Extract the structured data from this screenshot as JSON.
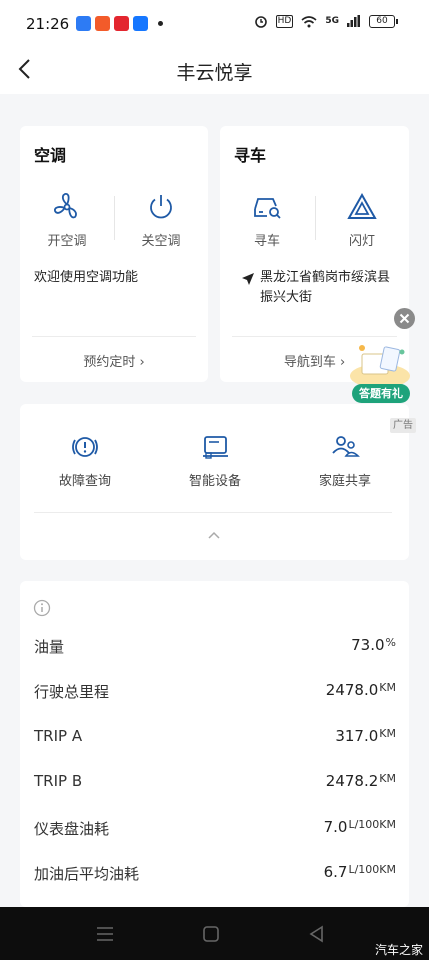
{
  "status_bar": {
    "time": "21:26",
    "battery": "60",
    "network": "5G",
    "hd": "HD"
  },
  "header": {
    "title": "丰云悦享"
  },
  "ac_card": {
    "title": "空调",
    "on_label": "开空调",
    "off_label": "关空调",
    "message": "欢迎使用空调功能",
    "link": "预约定时"
  },
  "find_card": {
    "title": "寻车",
    "find_label": "寻车",
    "flash_label": "闪灯",
    "address": "黑龙江省鹤岗市绥滨县振兴大街",
    "link": "导航到车"
  },
  "features": [
    {
      "label": "故障查询",
      "icon": "fault-icon"
    },
    {
      "label": "智能设备",
      "icon": "device-icon"
    },
    {
      "label": "家庭共享",
      "icon": "family-icon"
    }
  ],
  "promo": {
    "label": "答题有礼",
    "ad": "广告"
  },
  "vehicle_info": {
    "rows": [
      {
        "label": "油量",
        "value": "73.0",
        "unit": "%"
      },
      {
        "label": "行驶总里程",
        "value": "2478.0",
        "unit": "KM"
      },
      {
        "label": "TRIP A",
        "value": "317.0",
        "unit": "KM"
      },
      {
        "label": "TRIP B",
        "value": "2478.2",
        "unit": "KM"
      },
      {
        "label": "仪表盘油耗",
        "value": "7.0",
        "unit": "L/100KM"
      },
      {
        "label": "加油后平均油耗",
        "value": "6.7",
        "unit": "L/100KM"
      }
    ]
  },
  "watermark": "汽车之家",
  "colors": {
    "accent": "#1f5aa6",
    "promo_green": "#1ea37b"
  }
}
